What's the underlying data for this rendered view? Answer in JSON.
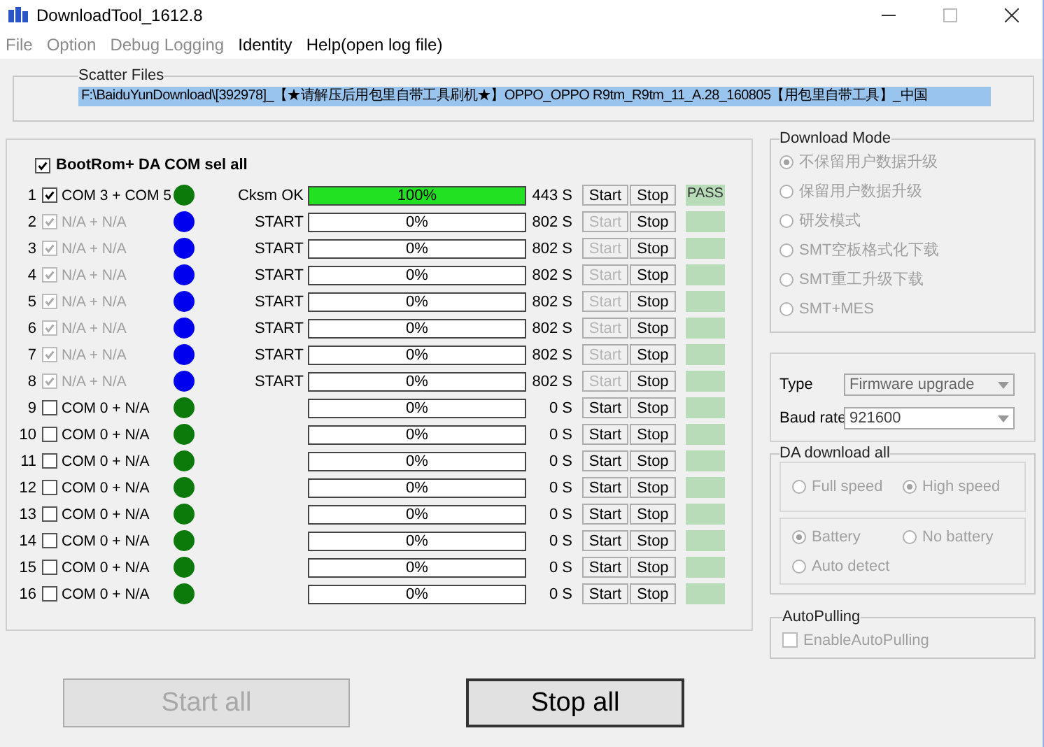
{
  "window": {
    "title": "DownloadTool_1612.8"
  },
  "menu": [
    {
      "label": "File",
      "disabled": true
    },
    {
      "label": "Option",
      "disabled": true
    },
    {
      "label": "Debug Logging",
      "disabled": true
    },
    {
      "label": "Identity",
      "disabled": false
    },
    {
      "label": "Help(open log file)",
      "disabled": false
    }
  ],
  "scatter_files": {
    "label": "Scatter Files",
    "value": "F:\\BaiduYunDownload\\[392978]_【★请解压后用包里自带工具刷机★】OPPO_OPPO R9tm_R9tm_11_A.28_160805【用包里自带工具】_中国"
  },
  "select_all": {
    "label": "BootRom+ DA COM sel all",
    "checked": true
  },
  "ports": [
    {
      "index": "1",
      "checked": true,
      "disabled": false,
      "label": "COM 3 + COM 5",
      "color": "#0b7a0b",
      "status": "Cksm OK",
      "level": 1,
      "progress": "100%",
      "time": "443 S",
      "start_disabled": false,
      "result": "PASS"
    },
    {
      "index": "2",
      "checked": true,
      "disabled": true,
      "label": "N/A + N/A",
      "color": "#0000ee",
      "status": "START",
      "level": 0,
      "progress": "0%",
      "time": "802 S",
      "start_disabled": true
    },
    {
      "index": "3",
      "checked": true,
      "disabled": true,
      "label": "N/A + N/A",
      "color": "#0000ee",
      "status": "START",
      "level": 0,
      "progress": "0%",
      "time": "802 S",
      "start_disabled": true
    },
    {
      "index": "4",
      "checked": true,
      "disabled": true,
      "label": "N/A + N/A",
      "color": "#0000ee",
      "status": "START",
      "level": 0,
      "progress": "0%",
      "time": "802 S",
      "start_disabled": true
    },
    {
      "index": "5",
      "checked": true,
      "disabled": true,
      "label": "N/A + N/A",
      "color": "#0000ee",
      "status": "START",
      "level": 0,
      "progress": "0%",
      "time": "802 S",
      "start_disabled": true
    },
    {
      "index": "6",
      "checked": true,
      "disabled": true,
      "label": "N/A + N/A",
      "color": "#0000ee",
      "status": "START",
      "level": 0,
      "progress": "0%",
      "time": "802 S",
      "start_disabled": true
    },
    {
      "index": "7",
      "checked": true,
      "disabled": true,
      "label": "N/A + N/A",
      "color": "#0000ee",
      "status": "START",
      "level": 0,
      "progress": "0%",
      "time": "802 S",
      "start_disabled": true
    },
    {
      "index": "8",
      "checked": true,
      "disabled": true,
      "label": "N/A + N/A",
      "color": "#0000ee",
      "status": "START",
      "level": 0,
      "progress": "0%",
      "time": "802 S",
      "start_disabled": true
    },
    {
      "index": "9",
      "checked": false,
      "disabled": false,
      "label": "COM 0 + N/A",
      "color": "#0b7a0b",
      "level": 0,
      "progress": "0%",
      "time": "0 S",
      "start_disabled": false
    },
    {
      "index": "10",
      "checked": false,
      "disabled": false,
      "label": "COM 0 + N/A",
      "color": "#0b7a0b",
      "level": 0,
      "progress": "0%",
      "time": "0 S",
      "start_disabled": false
    },
    {
      "index": "11",
      "checked": false,
      "disabled": false,
      "label": "COM 0 + N/A",
      "color": "#0b7a0b",
      "level": 0,
      "progress": "0%",
      "time": "0 S",
      "start_disabled": false
    },
    {
      "index": "12",
      "checked": false,
      "disabled": false,
      "label": "COM 0 + N/A",
      "color": "#0b7a0b",
      "level": 0,
      "progress": "0%",
      "time": "0 S",
      "start_disabled": false
    },
    {
      "index": "13",
      "checked": false,
      "disabled": false,
      "label": "COM 0 + N/A",
      "color": "#0b7a0b",
      "level": 0,
      "progress": "0%",
      "time": "0 S",
      "start_disabled": false
    },
    {
      "index": "14",
      "checked": false,
      "disabled": false,
      "label": "COM 0 + N/A",
      "color": "#0b7a0b",
      "level": 0,
      "progress": "0%",
      "time": "0 S",
      "start_disabled": false
    },
    {
      "index": "15",
      "checked": false,
      "disabled": false,
      "label": "COM 0 + N/A",
      "color": "#0b7a0b",
      "level": 0,
      "progress": "0%",
      "time": "0 S",
      "start_disabled": false
    },
    {
      "index": "16",
      "checked": false,
      "disabled": false,
      "label": "COM 0 + N/A",
      "color": "#0b7a0b",
      "level": 0,
      "progress": "0%",
      "time": "0 S",
      "start_disabled": false
    }
  ],
  "port_buttons": [
    {
      "start": "Start",
      "stop": "Stop"
    },
    {
      "start": "Start",
      "stop": "Stop"
    },
    {
      "start": "Start",
      "stop": "Stop"
    },
    {
      "start": "Start",
      "stop": "Stop"
    },
    {
      "start": "Start",
      "stop": "Stop"
    },
    {
      "start": "Start",
      "stop": "Stop"
    },
    {
      "start": "Start",
      "stop": "Stop"
    },
    {
      "start": "Start",
      "stop": "Stop"
    },
    {
      "start": "Start",
      "stop": "Stop"
    },
    {
      "start": "Start",
      "stop": "Stop"
    },
    {
      "start": "Start",
      "stop": "Stop"
    },
    {
      "start": "Start",
      "stop": "Stop"
    },
    {
      "start": "Start",
      "stop": "Stop"
    },
    {
      "start": "Start",
      "stop": "Stop"
    },
    {
      "start": "Start",
      "stop": "Stop"
    },
    {
      "start": "Start",
      "stop": "Stop"
    }
  ],
  "download_mode": {
    "title": "Download Mode",
    "options": [
      {
        "label": "不保留用户数据升级",
        "selected": true
      },
      {
        "label": "保留用户数据升级",
        "selected": false
      },
      {
        "label": "研发模式",
        "selected": false
      },
      {
        "label": "SMT空板格式化下载",
        "selected": false
      },
      {
        "label": "SMT重工升级下载",
        "selected": false
      },
      {
        "label": "SMT+MES",
        "selected": false
      }
    ]
  },
  "settings": {
    "type_label": "Type",
    "type_value": "Firmware upgrade",
    "baud_label": "Baud rate",
    "baud_value": "921600"
  },
  "da_download": {
    "title": "DA download all",
    "speed": [
      {
        "label": "Full speed",
        "selected": false
      },
      {
        "label": "High speed",
        "selected": true
      }
    ],
    "power": [
      {
        "label": "Battery",
        "selected": true
      },
      {
        "label": "No battery",
        "selected": false
      },
      {
        "label": "Auto detect",
        "selected": false
      }
    ]
  },
  "auto_pulling": {
    "title": "AutoPulling",
    "label": "EnableAutoPulling",
    "checked": false
  },
  "buttons": [
    {
      "label": "Start all",
      "disabled": true,
      "default": false
    },
    {
      "label": "Stop all",
      "disabled": false,
      "default": true
    }
  ]
}
